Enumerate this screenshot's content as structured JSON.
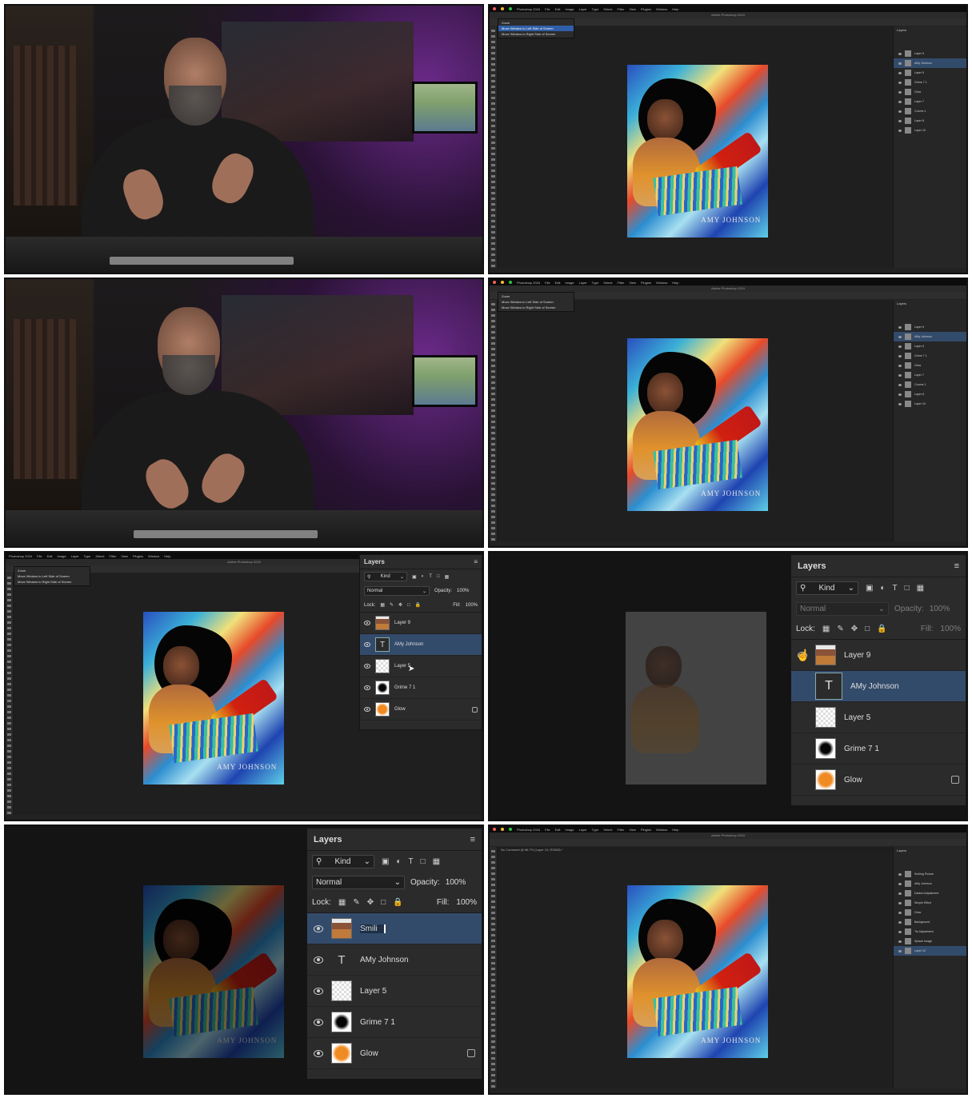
{
  "frames": [
    {
      "kind": "presenter"
    },
    {
      "kind": "photoshop",
      "menu": [
        "Photoshop 2024",
        "File",
        "Edit",
        "Image",
        "Layer",
        "Type",
        "Select",
        "Filter",
        "View",
        "Plugins",
        "Window",
        "Help"
      ],
      "title": "Adobe Photoshop 2024",
      "doc_menu": [
        "Zoom",
        "Move Window to Left Side of Screen",
        "Move Window to Right Side of Screen"
      ],
      "doc_menu_selected": 1,
      "artwork_text": "AMY JOHNSON",
      "right_layers": [
        "Layer 9",
        "AMy Johnson",
        "Layer 5",
        "Grime 7 1",
        "Glow",
        "Layer 7",
        "Curves 1",
        "Layer 8",
        "Layer 10"
      ],
      "right_selected": 1
    },
    {
      "kind": "presenter"
    },
    {
      "kind": "photoshop",
      "menu": [
        "Photoshop 2024",
        "File",
        "Edit",
        "Image",
        "Layer",
        "Type",
        "Select",
        "Filter",
        "View",
        "Plugins",
        "Window",
        "Help"
      ],
      "title": "Adobe Photoshop 2024",
      "doc_menu": [
        "Zoom",
        "Move Window to Left Side of Screen",
        "Move Window to Right Side of Screen"
      ],
      "doc_menu_selected": -1,
      "artwork_text": "AMY JOHNSON",
      "right_layers": [
        "Layer 9",
        "AMy Johnson",
        "Layer 5",
        "Grime 7 1",
        "Glow",
        "Layer 7",
        "Curves 1",
        "Layer 8",
        "Layer 10"
      ],
      "right_selected": 1
    },
    {
      "kind": "photoshop-zoomed",
      "menu": [
        "Photoshop 2024",
        "File",
        "Edit",
        "Image",
        "Layer",
        "Type",
        "Select",
        "Filter",
        "View",
        "Plugins",
        "Window",
        "Help"
      ],
      "title": "Adobe Photoshop 2024",
      "doc_menu": [
        "Zoom",
        "Move Window to Left Side of Screen",
        "Move Window to Right Side of Screen"
      ],
      "artwork_text": "AMY JOHNSON"
    },
    {
      "kind": "photoshop-faded"
    },
    {
      "kind": "photoshop-rename",
      "artwork_text": "AMY JOHNSON"
    },
    {
      "kind": "photoshop",
      "menu": [
        "Photoshop 2024",
        "File",
        "Edit",
        "Image",
        "Layer",
        "Type",
        "Select",
        "Filter",
        "View",
        "Plugins",
        "Window",
        "Help"
      ],
      "title": "Adobe Photoshop 2024",
      "doc_menu": [],
      "doc_menu_selected": -1,
      "doc_tab": "No Comment @ 66.7% (Layer 10, RGB/8) *",
      "artwork_text": "AMY JOHNSON",
      "right_layers": [
        "Smiling Picture",
        "AMy Johnson",
        "Darken Adjustment",
        "Simple Effect",
        "Glow",
        "Background",
        "Tie Adjustment",
        "Splash Image",
        "Layer 12"
      ],
      "right_selected": 8
    }
  ],
  "layers_panel": {
    "title": "Layers",
    "filter_label": "Kind",
    "blend_mode": "Normal",
    "opacity_label": "Opacity:",
    "opacity_value": "100%",
    "lock_label": "Lock:",
    "fill_label": "Fill:",
    "fill_value": "100%",
    "layers": [
      {
        "name": "Layer 9",
        "thumb": "face"
      },
      {
        "name": "AMy Johnson",
        "thumb": "text",
        "glyph": "T"
      },
      {
        "name": "Layer 5",
        "thumb": "blank"
      },
      {
        "name": "Grime 7 1",
        "thumb": "grime"
      },
      {
        "name": "Glow",
        "thumb": "glow"
      }
    ],
    "rename_value": "Smili"
  },
  "icons": {
    "search": "search-icon",
    "eye": "eye-icon",
    "text_layer": "T",
    "menu": "≡"
  }
}
